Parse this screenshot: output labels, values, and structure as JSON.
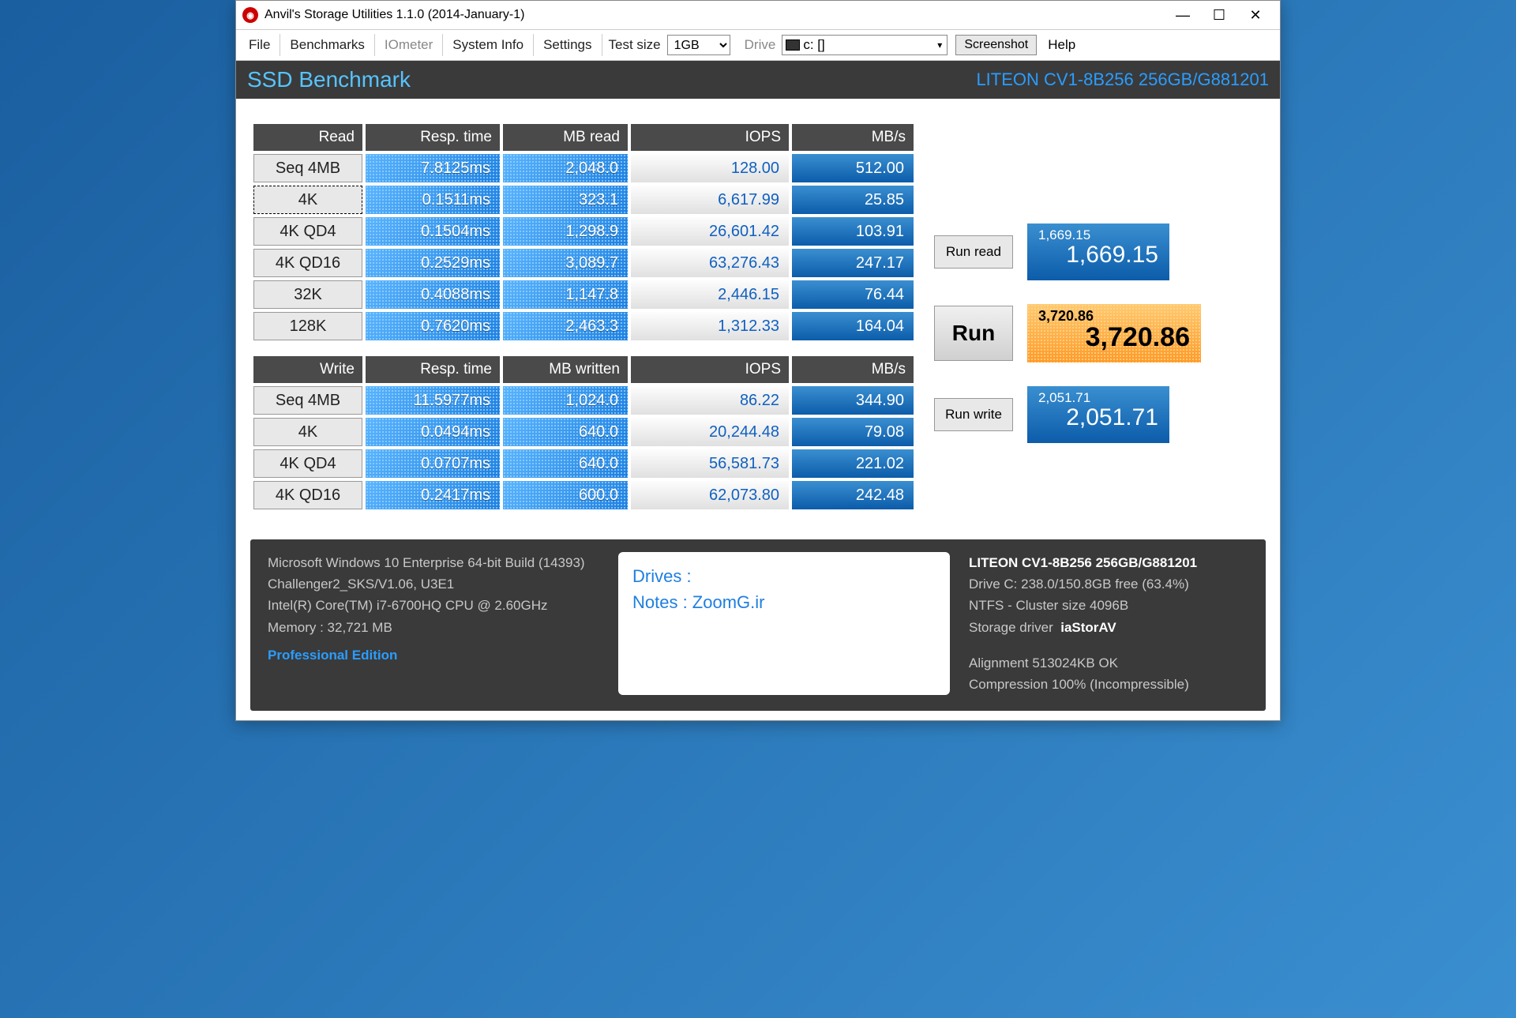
{
  "window": {
    "title": "Anvil's Storage Utilities 1.1.0 (2014-January-1)"
  },
  "menu": {
    "file": "File",
    "benchmarks": "Benchmarks",
    "iometer": "IOmeter",
    "systeminfo": "System Info",
    "settings": "Settings",
    "testsize_label": "Test size",
    "testsize_value": "1GB",
    "drive_label": "Drive",
    "drive_value": "c: []",
    "screenshot": "Screenshot",
    "help": "Help"
  },
  "header": {
    "title": "SSD Benchmark",
    "device": "LITEON CV1-8B256 256GB/G881201"
  },
  "read": {
    "heading": "Read",
    "cols": {
      "resp": "Resp. time",
      "mb": "MB read",
      "iops": "IOPS",
      "mbs": "MB/s"
    },
    "rows": [
      {
        "label": "Seq 4MB",
        "resp": "7.8125ms",
        "mb": "2,048.0",
        "iops": "128.00",
        "mbs": "512.00"
      },
      {
        "label": "4K",
        "resp": "0.1511ms",
        "mb": "323.1",
        "iops": "6,617.99",
        "mbs": "25.85"
      },
      {
        "label": "4K QD4",
        "resp": "0.1504ms",
        "mb": "1,298.9",
        "iops": "26,601.42",
        "mbs": "103.91"
      },
      {
        "label": "4K QD16",
        "resp": "0.2529ms",
        "mb": "3,089.7",
        "iops": "63,276.43",
        "mbs": "247.17"
      },
      {
        "label": "32K",
        "resp": "0.4088ms",
        "mb": "1,147.8",
        "iops": "2,446.15",
        "mbs": "76.44"
      },
      {
        "label": "128K",
        "resp": "0.7620ms",
        "mb": "2,463.3",
        "iops": "1,312.33",
        "mbs": "164.04"
      }
    ]
  },
  "write": {
    "heading": "Write",
    "cols": {
      "resp": "Resp. time",
      "mb": "MB written",
      "iops": "IOPS",
      "mbs": "MB/s"
    },
    "rows": [
      {
        "label": "Seq 4MB",
        "resp": "11.5977ms",
        "mb": "1,024.0",
        "iops": "86.22",
        "mbs": "344.90"
      },
      {
        "label": "4K",
        "resp": "0.0494ms",
        "mb": "640.0",
        "iops": "20,244.48",
        "mbs": "79.08"
      },
      {
        "label": "4K QD4",
        "resp": "0.0707ms",
        "mb": "640.0",
        "iops": "56,581.73",
        "mbs": "221.02"
      },
      {
        "label": "4K QD16",
        "resp": "0.2417ms",
        "mb": "600.0",
        "iops": "62,073.80",
        "mbs": "242.48"
      }
    ]
  },
  "scores": {
    "run_read": "Run read",
    "run": "Run",
    "run_write": "Run write",
    "read_small": "1,669.15",
    "read_large": "1,669.15",
    "total_small": "3,720.86",
    "total_large": "3,720.86",
    "write_small": "2,051.71",
    "write_large": "2,051.71"
  },
  "footer": {
    "os": "Microsoft Windows 10 Enterprise 64-bit Build (14393)",
    "board": "Challenger2_SKS/V1.06, U3E1",
    "cpu": "Intel(R) Core(TM) i7-6700HQ CPU @ 2.60GHz",
    "memory": "Memory : 32,721 MB",
    "edition": "Professional Edition",
    "notes_drives": "Drives :",
    "notes_notes": "Notes : ZoomG.ir",
    "drive_title": "LITEON CV1-8B256 256GB/G881201",
    "drive_cap": "Drive C: 238.0/150.8GB free (63.4%)",
    "drive_fs": "NTFS - Cluster size 4096B",
    "drive_driver_label": "Storage driver",
    "drive_driver": "iaStorAV",
    "drive_align": "Alignment 513024KB OK",
    "drive_comp": "Compression 100% (Incompressible)"
  }
}
